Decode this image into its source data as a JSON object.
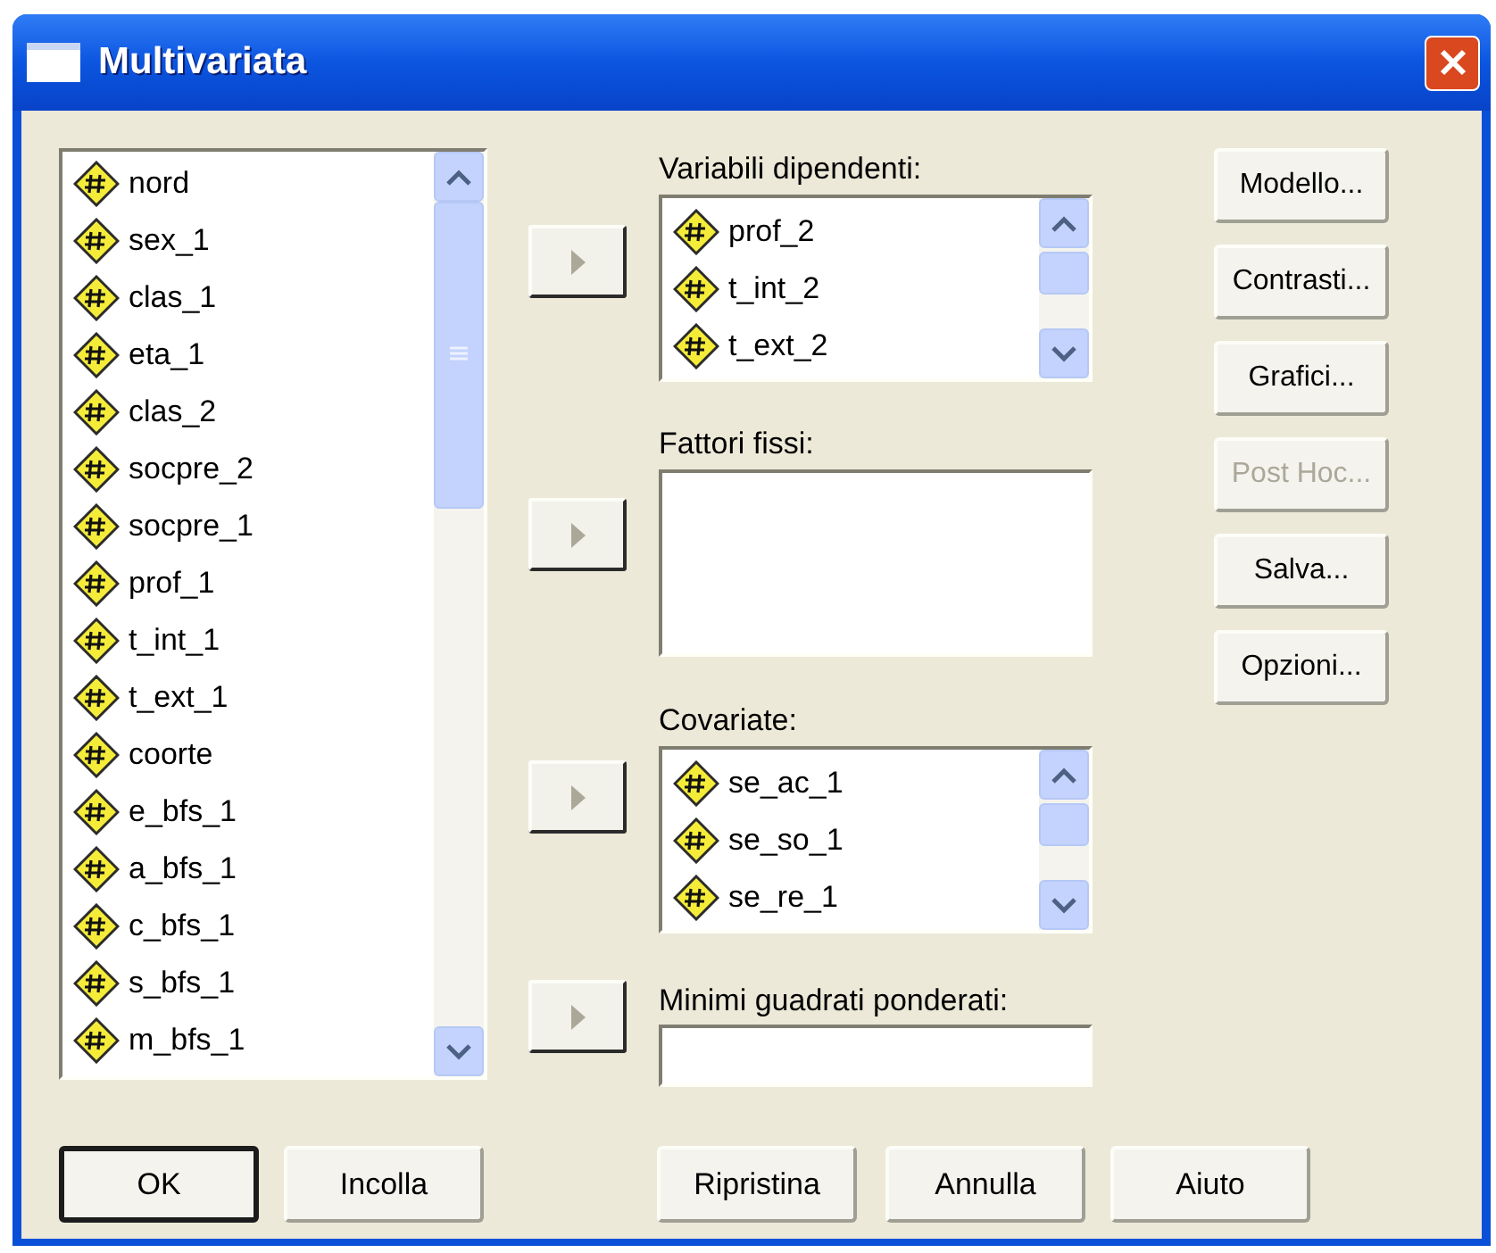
{
  "window": {
    "title": "Multivariata"
  },
  "source_list": {
    "items": [
      {
        "label": "nord"
      },
      {
        "label": "sex_1"
      },
      {
        "label": "clas_1"
      },
      {
        "label": "eta_1"
      },
      {
        "label": "clas_2"
      },
      {
        "label": "socpre_2"
      },
      {
        "label": "socpre_1"
      },
      {
        "label": "prof_1"
      },
      {
        "label": "t_int_1"
      },
      {
        "label": "t_ext_1"
      },
      {
        "label": "coorte"
      },
      {
        "label": "e_bfs_1"
      },
      {
        "label": "a_bfs_1"
      },
      {
        "label": "c_bfs_1"
      },
      {
        "label": "s_bfs_1"
      },
      {
        "label": "m_bfs_1"
      }
    ]
  },
  "targets": [
    {
      "label": "Variabili dipendenti:",
      "kind": "list",
      "arrow_disabled": true,
      "items": [
        {
          "label": "prof_2"
        },
        {
          "label": "t_int_2"
        },
        {
          "label": "t_ext_2"
        }
      ]
    },
    {
      "label": "Fattori fissi:",
      "kind": "list",
      "arrow_disabled": true
    },
    {
      "label": "Covariate:",
      "kind": "list",
      "arrow_disabled": true,
      "items": [
        {
          "label": "se_ac_1"
        },
        {
          "label": "se_so_1"
        },
        {
          "label": "se_re_1"
        }
      ]
    },
    {
      "label": "Minimi guadrati ponderati:",
      "kind": "field",
      "arrow_disabled": true
    }
  ],
  "side_buttons": [
    {
      "label": "Modello...",
      "disabled": false
    },
    {
      "label": "Contrasti...",
      "disabled": false
    },
    {
      "label": "Grafici...",
      "disabled": false
    },
    {
      "label": "Post Hoc...",
      "disabled": true
    },
    {
      "label": "Salva...",
      "disabled": false
    },
    {
      "label": "Opzioni...",
      "disabled": false
    }
  ],
  "bottom_buttons": [
    {
      "label": "OK",
      "default": true
    },
    {
      "label": "Incolla",
      "default": false
    },
    {
      "label": "Ripristina",
      "default": false
    },
    {
      "label": "Annulla",
      "default": false
    },
    {
      "label": "Aiuto",
      "default": false
    }
  ]
}
